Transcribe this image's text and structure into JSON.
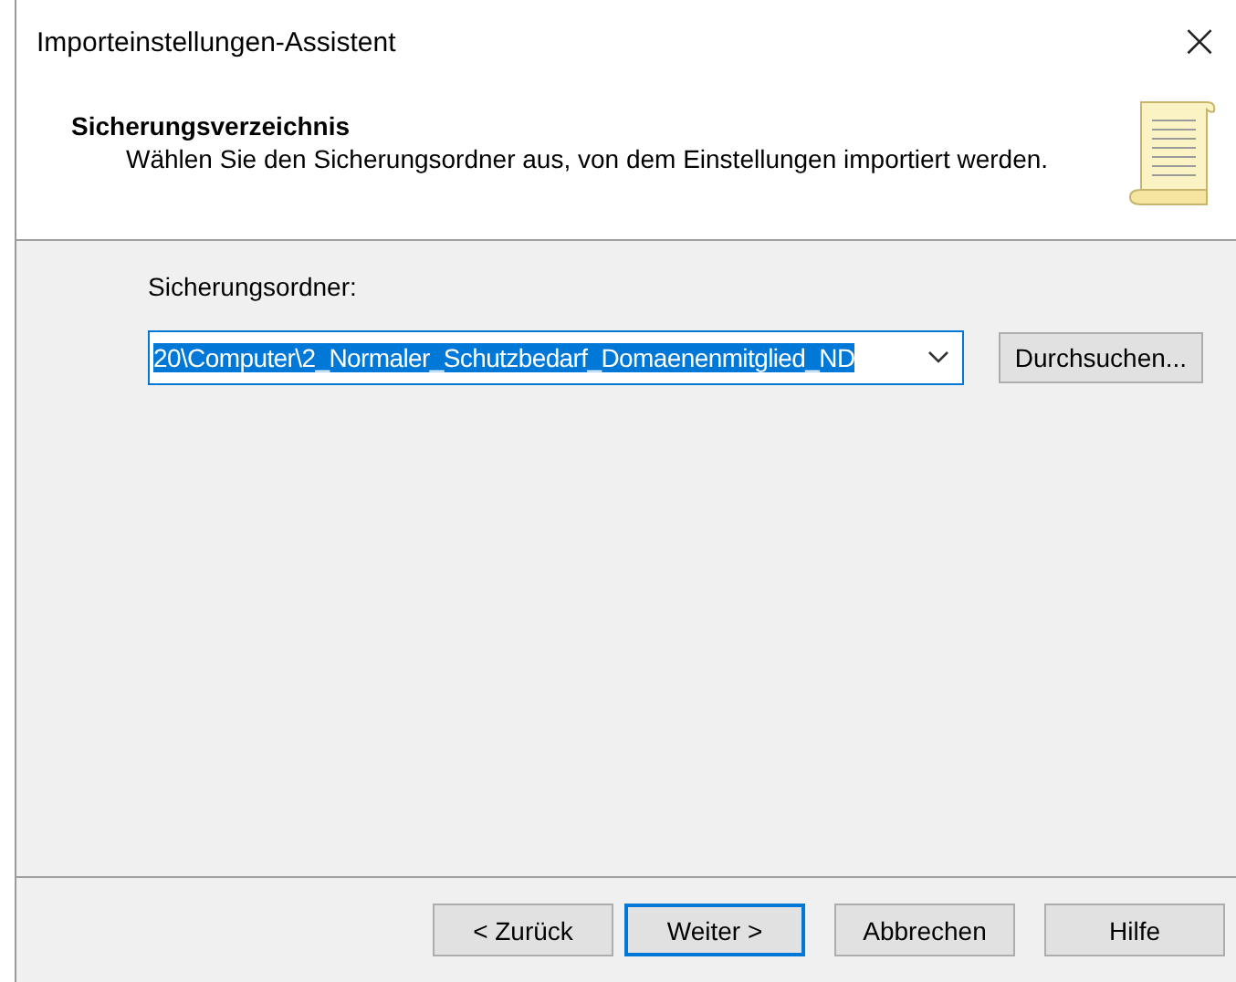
{
  "window": {
    "title": "Importeinstellungen-Assistent",
    "close": "×"
  },
  "header": {
    "title": "Sicherungsverzeichnis",
    "subtitle": "Wählen Sie den Sicherungsordner aus, von dem Einstellungen importiert werden."
  },
  "folder_field": {
    "label": "Sicherungsordner:",
    "value": "20\\Computer\\2_Normaler_Schutzbedarf_Domaenenmitglied_ND",
    "selected": true
  },
  "browse_button": "Durchsuchen...",
  "buttons": [
    {
      "label": "< Zurück",
      "default": false
    },
    {
      "label": "Weiter >",
      "default": true
    },
    {
      "label": "Abbrechen",
      "default": false
    },
    {
      "label": "Hilfe",
      "default": false
    }
  ]
}
